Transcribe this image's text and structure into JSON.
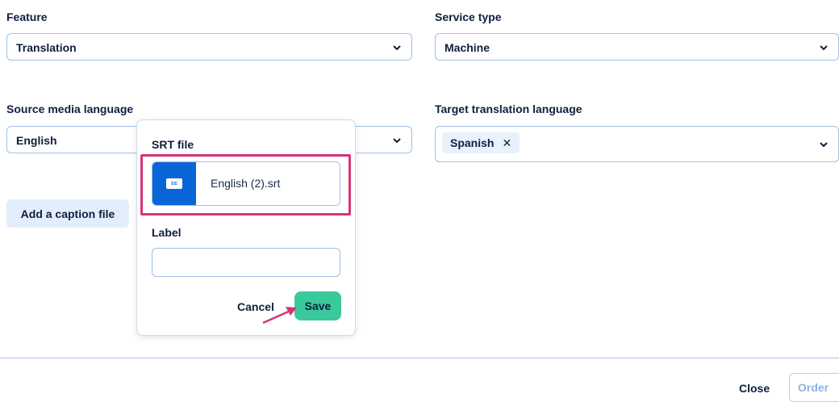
{
  "form": {
    "feature": {
      "label": "Feature",
      "value": "Translation"
    },
    "service_type": {
      "label": "Service type",
      "value": "Machine"
    },
    "source_language": {
      "label": "Source media language",
      "value": "English"
    },
    "target_language": {
      "label": "Target translation language",
      "tags": [
        "Spanish"
      ],
      "tag_remove_glyph": "✕"
    },
    "add_caption_label": "Add a caption file"
  },
  "popover": {
    "srt_label": "SRT file",
    "file_icon_text": "cc",
    "file_name": "English (2).srt",
    "label_field_label": "Label",
    "label_value": "",
    "cancel_label": "Cancel",
    "save_label": "Save"
  },
  "footer": {
    "close_label": "Close",
    "order_label": "Order"
  },
  "colors": {
    "accent_blue": "#0a66d6",
    "save_green": "#39c99b",
    "highlight_pink": "#d6337a"
  },
  "icons": {
    "dropdown": "chevron-down-icon",
    "file": "closed-caption-icon",
    "annotation": "arrow-icon"
  }
}
